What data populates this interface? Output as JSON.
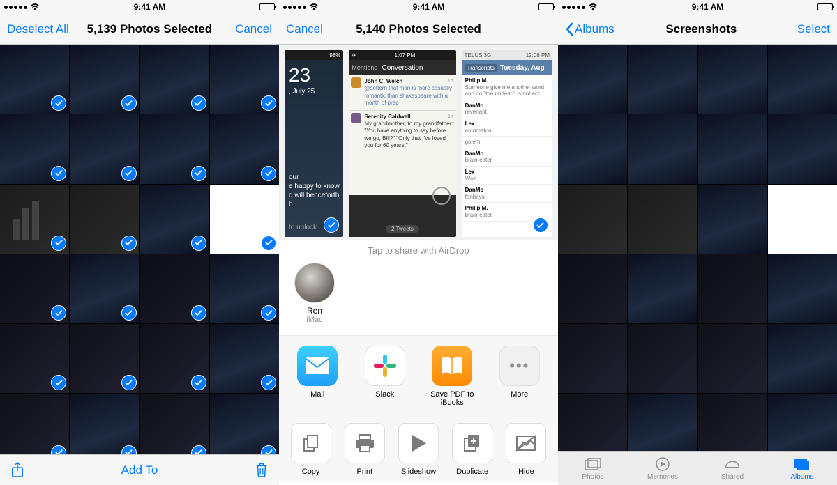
{
  "statusBar": {
    "time": "9:41 AM"
  },
  "screen1": {
    "nav": {
      "left": "Deselect All",
      "title": "5,139 Photos Selected",
      "right": "Cancel"
    },
    "toolbar": {
      "addTo": "Add To"
    }
  },
  "screen2": {
    "nav": {
      "left": "Cancel",
      "title": "5,140 Photos Selected"
    },
    "previews": {
      "p1": {
        "status_time": "98%",
        "bignum": "23",
        "sub": ", July 25",
        "lines": [
          "our",
          "e happy to know",
          "d will henceforth b"
        ],
        "unlock": "to unlock"
      },
      "p2": {
        "status_time": "1:07 PM",
        "nav_left": "Mentions",
        "nav_title": "Conversation",
        "tweets": [
          {
            "name": "John C. Welch",
            "time": "1h",
            "text": "@settern that man is more casually romantic than shakespeare with a month of prep"
          },
          {
            "name": "Serenity Caldwell",
            "time": "1h",
            "text": "My grandmother, to my grandfather: \"You have anything to say before we go, Bill?\"\n\"Only that I've loved you for 60 years.\""
          }
        ],
        "footer": "2 Tweets"
      },
      "p3": {
        "carrier": "TELUS 3G",
        "status_time": "12:08 PM",
        "nav_left": "Transcripts",
        "nav_title": "Tuesday, Aug",
        "rows": [
          {
            "name": "Philip M.",
            "sub": "Someone give me another word and no \"the undead\" is not acc"
          },
          {
            "name": "DanMo",
            "sub": "revenant"
          },
          {
            "name": "Lex",
            "sub": "automaton"
          },
          {
            "name": "",
            "sub": "golem"
          },
          {
            "name": "DanMo",
            "sub": "brain-eater"
          },
          {
            "name": "Lex",
            "sub": "Woz"
          },
          {
            "name": "DanMo",
            "sub": "fanboys"
          },
          {
            "name": "Philip M.",
            "sub": "brain-eater"
          }
        ]
      }
    },
    "airdrop": {
      "hint": "Tap to share with AirDrop",
      "target": {
        "name": "Ren",
        "device": "iMac"
      }
    },
    "apps": [
      {
        "label": "Mail"
      },
      {
        "label": "Slack"
      },
      {
        "label": "Save PDF to iBooks"
      },
      {
        "label": "More"
      }
    ],
    "actions": [
      {
        "label": "Copy"
      },
      {
        "label": "Print"
      },
      {
        "label": "Slideshow"
      },
      {
        "label": "Duplicate"
      },
      {
        "label": "Hide"
      }
    ]
  },
  "screen3": {
    "nav": {
      "back": "Albums",
      "title": "Screenshots",
      "right": "Select"
    },
    "tabs": [
      {
        "label": "Photos"
      },
      {
        "label": "Memories"
      },
      {
        "label": "Shared"
      },
      {
        "label": "Albums"
      }
    ],
    "activeTab": 3
  }
}
